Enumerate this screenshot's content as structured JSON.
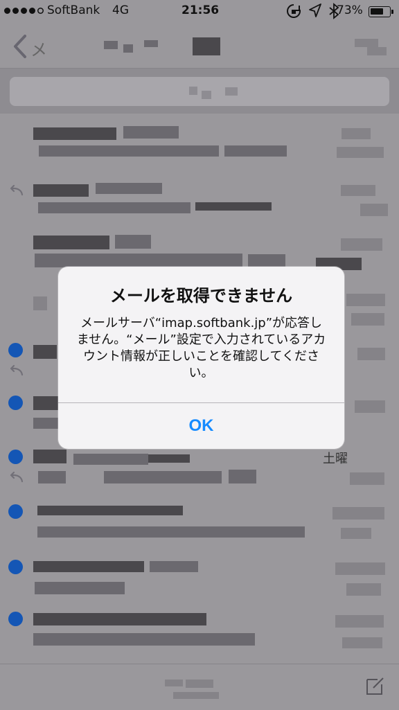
{
  "status_bar": {
    "carrier": "SoftBank",
    "network": "4G",
    "time": "21:56",
    "battery_percent": "73%",
    "battery_level": 0.73,
    "icons": [
      "orientation-lock-icon",
      "location-arrow-icon",
      "bluetooth-icon",
      "battery-icon"
    ]
  },
  "navigation": {
    "back_label": "メ",
    "back_icon": "chevron-left-icon"
  },
  "mail_list": {
    "visible_weekday": "土曜"
  },
  "alert": {
    "title": "メールを取得できません",
    "message": "メールサーバ“imap.softbank.jp”が応答しません。“メール”設定で入力されているアカウント情報が正しいことを確認してください。",
    "button_label": "OK",
    "button_color": "#168bff"
  },
  "colors": {
    "dimmed_background": "#9a989c",
    "unread_dot": "#1456b5",
    "alert_background": "#f7f6f8"
  }
}
